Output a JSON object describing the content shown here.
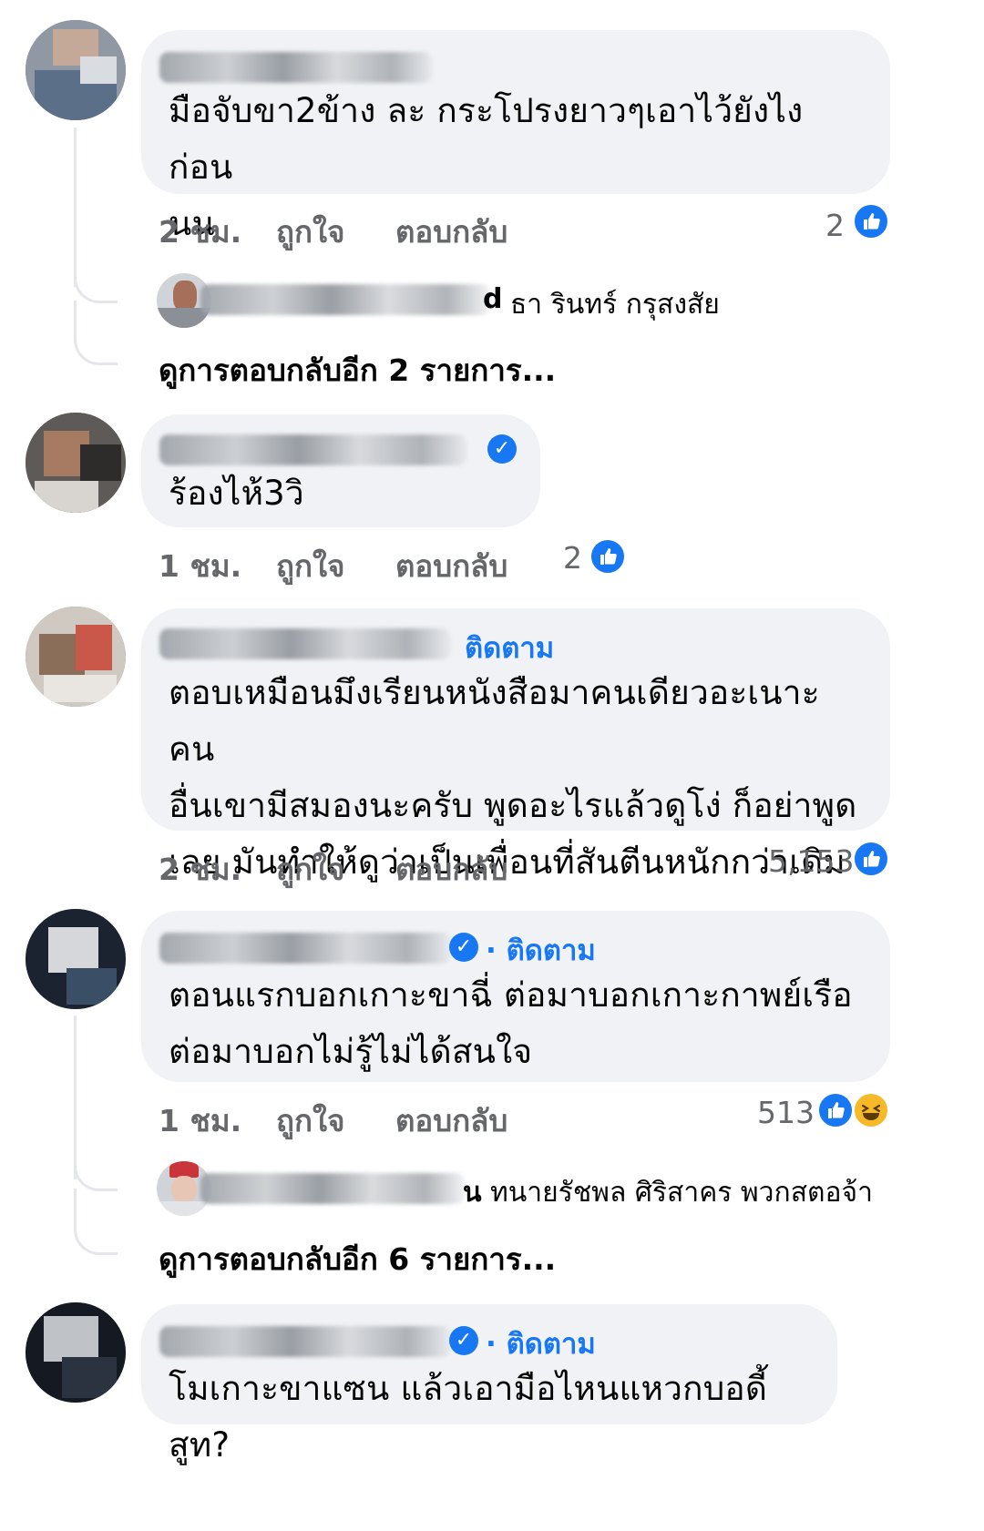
{
  "comments": [
    {
      "text_lines": [
        "มือจับขา2ข้าง ละ กระโปรงยาวๆเอาไว้ยังไง ก่อน",
        "นน"
      ],
      "time": "2 ชม.",
      "like_label": "ถูกใจ",
      "reply_label": "ตอบกลับ",
      "reaction_count": "2",
      "reactions": [
        "like-icon"
      ],
      "reply_preview": "ธา รินทร์ กรุสงสัย",
      "reply_preview_name_tail": "d",
      "more_replies": "ดูการตอบกลับอีก 2 รายการ..."
    },
    {
      "text_lines": [
        "ร้องไห้3วิ"
      ],
      "time": "1 ชม.",
      "like_label": "ถูกใจ",
      "reply_label": "ตอบกลับ",
      "reaction_count": "2",
      "reactions": [
        "like-icon"
      ],
      "verified": true
    },
    {
      "follow": "ติดตาม",
      "text_lines": [
        "ตอบเหมือนมึงเรียนหนังสือมาคนเดียวอะเนาะ คน",
        "อื่นเขามีสมองนะครับ พูดอะไรแล้วดูโง่ ก็อย่าพูด",
        "เลย มันทำให้ดูว่าเป็นเพื่อนที่สันตีนหนักกว่าเดิม"
      ],
      "time": "2 ชม.",
      "like_label": "ถูกใจ",
      "reply_label": "ตอบกลับ",
      "reaction_count": "5,153",
      "reactions": [
        "like-icon"
      ]
    },
    {
      "follow": "· ติดตาม",
      "verified": true,
      "text_lines": [
        "ตอนแรกบอกเกาะขาฉี่ ต่อมาบอกเกาะกาพย์เรือ",
        "ต่อมาบอกไม่รู้ไม่ได้สนใจ"
      ],
      "time": "1 ชม.",
      "like_label": "ถูกใจ",
      "reply_label": "ตอบกลับ",
      "reaction_count": "513",
      "reactions": [
        "like-icon",
        "haha-icon"
      ],
      "reply_preview": "ทนายรัชพล ศิริสาคร พวกสตอจ้า",
      "reply_preview_name_tail": "น",
      "more_replies": "ดูการตอบกลับอีก 6 รายการ..."
    },
    {
      "follow": "· ติดตาม",
      "verified": true,
      "text_lines": [
        "โมเกาะขาแซน แล้วเอามือไหนแหวกบอดี้สูท?"
      ]
    }
  ],
  "colors": {
    "accent": "#1877f2",
    "bubble": "#f0f2f5",
    "meta": "#65676b",
    "haha": "#f7b928"
  }
}
